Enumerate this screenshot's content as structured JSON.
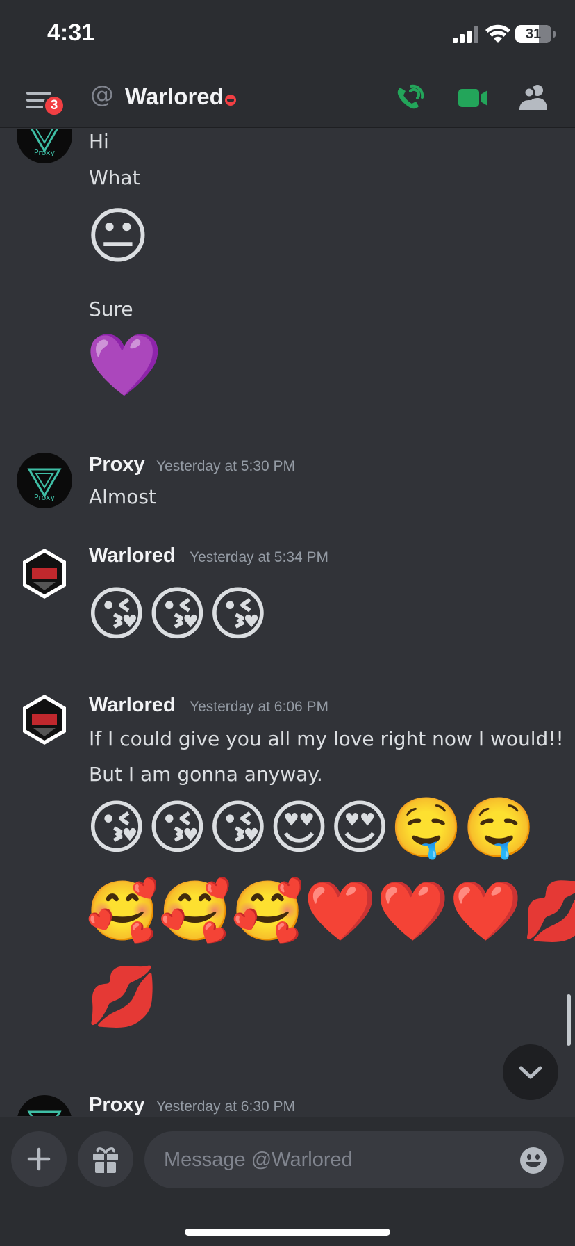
{
  "status_bar": {
    "time": "4:31",
    "battery": "31",
    "battery_level": 0.31
  },
  "header": {
    "badge_count": "3",
    "title": "Warlored"
  },
  "messages": {
    "top_lines": [
      "Hi",
      "What",
      "😐",
      "Sure",
      "💜"
    ],
    "msg1": {
      "author": "Proxy",
      "time": "Yesterday at 5:30 PM",
      "text": "Almost"
    },
    "msg2": {
      "author": "Warlored",
      "time": "Yesterday at 5:34 PM",
      "emoji": "😘😘😘"
    },
    "msg3": {
      "author": "Warlored",
      "time": "Yesterday at 6:06 PM",
      "text1": "If I could give you all my love right now I would!!",
      "text2": "But I am gonna anyway.",
      "emoji1": "😘😘😘😍😍🤤🤤",
      "emoji2": "🥰🥰🥰❤️❤️❤️💋",
      "emoji3": "💋"
    },
    "msg4": {
      "author": "Proxy",
      "time": "Yesterday at 6:30 PM"
    },
    "avatar_label": "Proxy"
  },
  "composer": {
    "placeholder": "Message @Warlored"
  },
  "icons": {
    "menu": "hamburger-icon",
    "call": "phone-icon",
    "video": "video-camera-icon",
    "members": "members-icon",
    "add": "plus-icon",
    "gift": "gift-icon",
    "emoji": "smiley-icon",
    "jump": "chevron-down-icon"
  },
  "colors": {
    "accent_green": "#23a55a",
    "dnd_red": "#f23f43",
    "background": "#313338"
  }
}
